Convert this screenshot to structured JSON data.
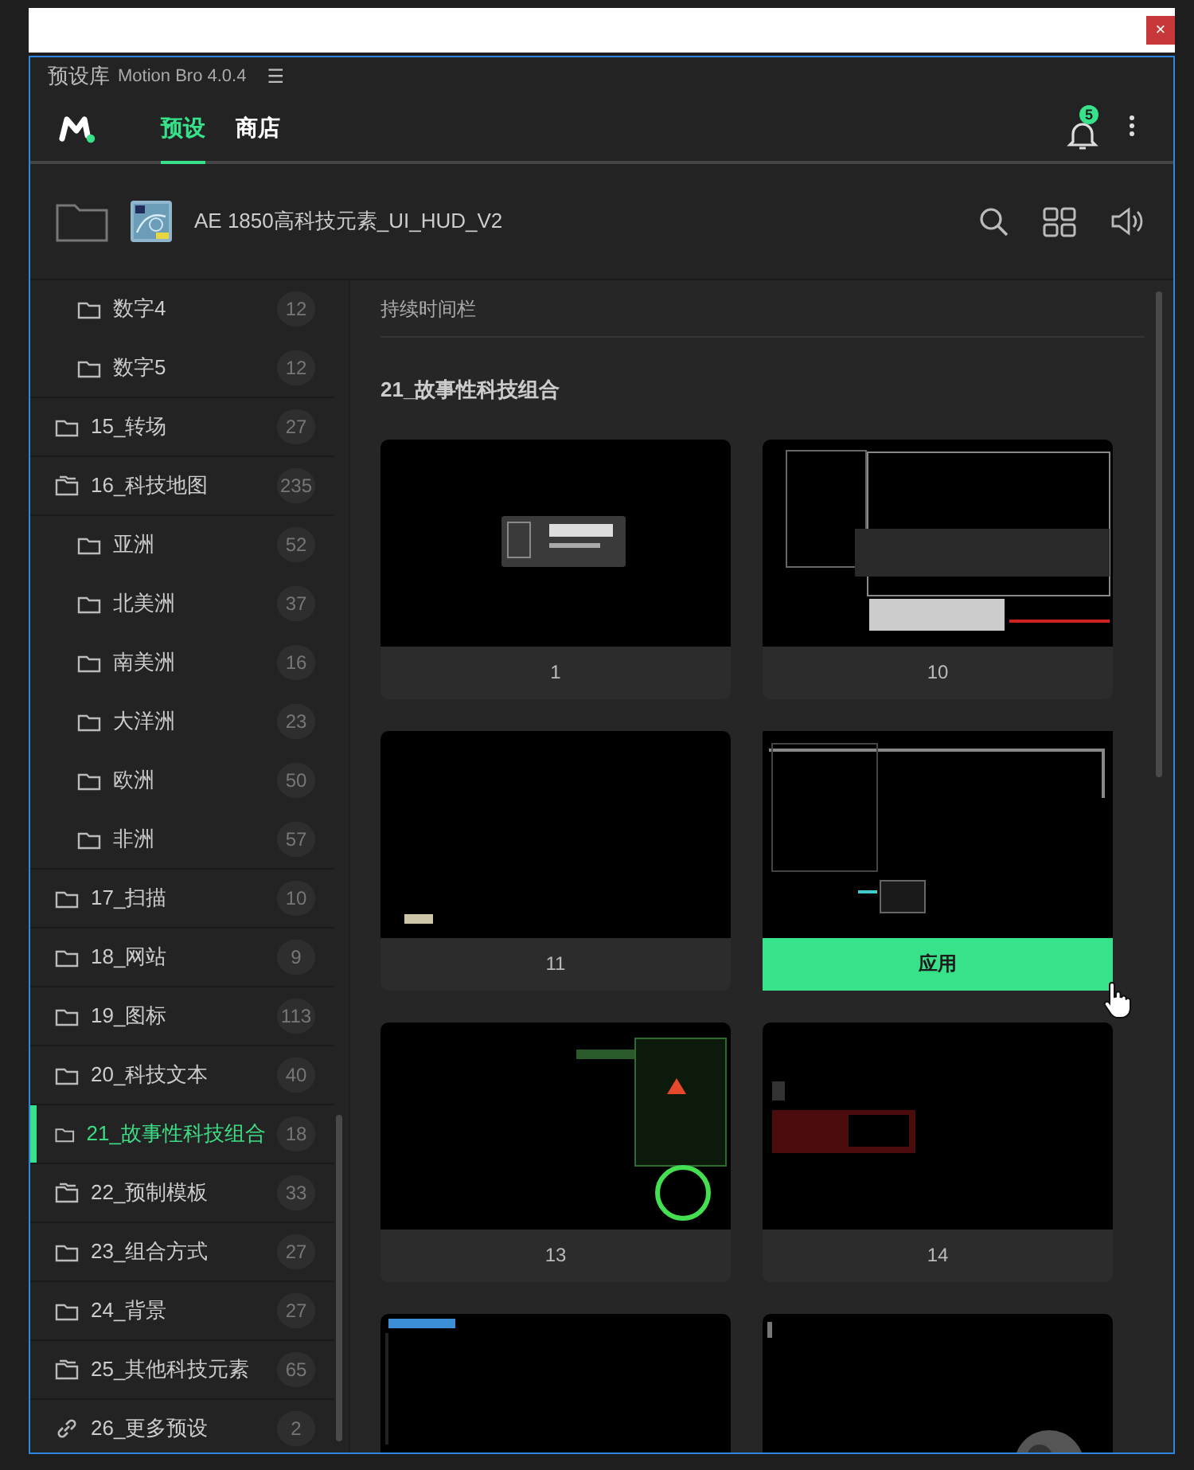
{
  "dialog_bar": {
    "close": "×"
  },
  "panel": {
    "title": "预设库",
    "version": "Motion Bro 4.0.4",
    "menu": "☰"
  },
  "header": {
    "tabs": [
      {
        "label": "预设",
        "selected": true
      },
      {
        "label": "商店",
        "selected": false
      }
    ],
    "notifications": "5"
  },
  "toolbar": {
    "pack_title": "AE 1850高科技元素_UI_HUD_V2"
  },
  "sidebar": {
    "items": [
      {
        "label": "数字4",
        "count": "12",
        "kind": "subfolder",
        "selected": false
      },
      {
        "label": "数字5",
        "count": "12",
        "kind": "subfolder",
        "selected": false
      },
      {
        "label": "15_转场",
        "count": "27",
        "kind": "folder",
        "selected": false
      },
      {
        "label": "16_科技地图",
        "count": "235",
        "kind": "folder-group",
        "selected": false,
        "children": [
          {
            "label": "亚洲",
            "count": "52",
            "kind": "subfolder",
            "selected": false
          },
          {
            "label": "北美洲",
            "count": "37",
            "kind": "subfolder",
            "selected": false
          },
          {
            "label": "南美洲",
            "count": "16",
            "kind": "subfolder",
            "selected": false
          },
          {
            "label": "大洋洲",
            "count": "23",
            "kind": "subfolder",
            "selected": false
          },
          {
            "label": "欧洲",
            "count": "50",
            "kind": "subfolder",
            "selected": false
          },
          {
            "label": "非洲",
            "count": "57",
            "kind": "subfolder",
            "selected": false
          }
        ]
      },
      {
        "label": "17_扫描",
        "count": "10",
        "kind": "folder",
        "selected": false
      },
      {
        "label": "18_网站",
        "count": "9",
        "kind": "folder",
        "selected": false
      },
      {
        "label": "19_图标",
        "count": "113",
        "kind": "folder",
        "selected": false
      },
      {
        "label": "20_科技文本",
        "count": "40",
        "kind": "folder",
        "selected": false
      },
      {
        "label": "21_故事性科技组合",
        "count": "18",
        "kind": "folder",
        "selected": true
      },
      {
        "label": "22_预制模板",
        "count": "33",
        "kind": "folder-group",
        "selected": false
      },
      {
        "label": "23_组合方式",
        "count": "27",
        "kind": "folder",
        "selected": false
      },
      {
        "label": "24_背景",
        "count": "27",
        "kind": "folder",
        "selected": false
      },
      {
        "label": "25_其他科技元素",
        "count": "65",
        "kind": "folder-group",
        "selected": false
      },
      {
        "label": "26_更多预设",
        "count": "2",
        "kind": "link",
        "selected": false
      }
    ]
  },
  "content": {
    "filter_label": "持续时间栏",
    "heading": "21_故事性科技组合",
    "cards": [
      {
        "kind": "preset",
        "label": "1"
      },
      {
        "kind": "preset",
        "label": "10"
      },
      {
        "kind": "preset",
        "label": "11"
      },
      {
        "kind": "hover",
        "button": "应用"
      },
      {
        "kind": "preset",
        "label": "13"
      },
      {
        "kind": "preset",
        "label": "14"
      },
      {
        "kind": "preset"
      },
      {
        "kind": "preset"
      }
    ]
  }
}
